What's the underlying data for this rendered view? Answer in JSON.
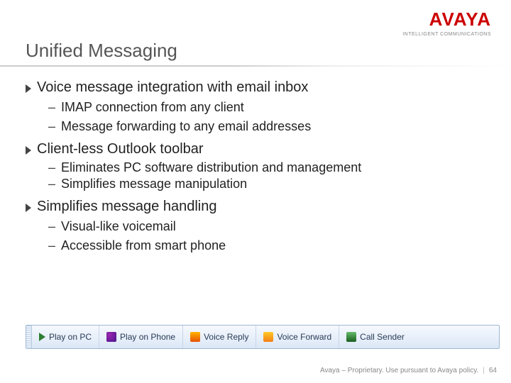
{
  "brand": {
    "name": "AVAYA",
    "tagline": "INTELLIGENT COMMUNICATIONS"
  },
  "title": "Unified Messaging",
  "bullets": [
    {
      "text": "Voice message integration with email inbox",
      "sub": [
        "IMAP connection from any client",
        "Message forwarding to any email addresses"
      ]
    },
    {
      "text": "Client-less Outlook toolbar",
      "sub": [
        "Eliminates PC software distribution and management",
        "Simplifies message manipulation"
      ]
    },
    {
      "text": "Simplifies message handling",
      "sub": [
        "Visual-like voicemail",
        "Accessible from smart phone"
      ]
    }
  ],
  "toolbar": [
    "Play on PC",
    "Play on Phone",
    "Voice Reply",
    "Voice Forward",
    "Call Sender"
  ],
  "footer": {
    "text": "Avaya – Proprietary. Use pursuant to Avaya policy.",
    "page": "64"
  }
}
